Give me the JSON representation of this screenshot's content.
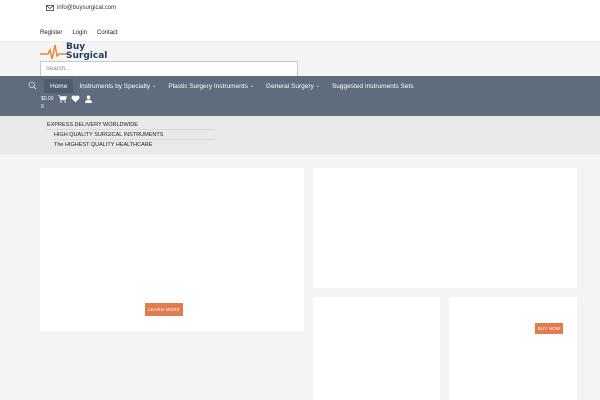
{
  "topbar": {
    "email": "info@buysurgical.com",
    "links": [
      {
        "label": "Register"
      },
      {
        "label": "Login"
      },
      {
        "label": "Contact"
      }
    ]
  },
  "logo": {
    "line1": "Buy",
    "line2": "Surgical"
  },
  "search": {
    "placeholder": "Search..."
  },
  "nav": {
    "items": [
      {
        "label": "Home",
        "active": true,
        "dropdown": false
      },
      {
        "label": "Instruments by Specialty",
        "dropdown": true
      },
      {
        "label": "Plastic Surgery Instruments",
        "dropdown": true
      },
      {
        "label": "General Surgery",
        "dropdown": true
      },
      {
        "label": "Suggested Instruments Sets",
        "dropdown": false
      }
    ]
  },
  "cart": {
    "price": "$0.00",
    "count": "0"
  },
  "promo": {
    "lines": [
      "EXPRESS DELIVERY WORLDWIDE",
      "HIGH QUALITY SURGICAL INSTRUMENTS",
      "The HIGHEST QUALITY HEALTHCARE"
    ]
  },
  "banners": {
    "learn_more": "LEARN MORE",
    "buy_now": "BUY NOW"
  },
  "colors": {
    "nav_bg": "#5e6c7e",
    "button": "#e27c4f",
    "brand": "#1e3a5f",
    "logo_accent": "#e8873a"
  }
}
